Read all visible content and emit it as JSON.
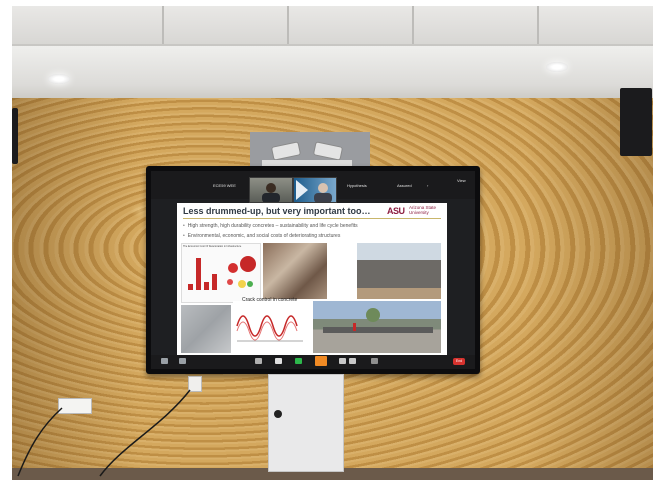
{
  "scene": {
    "description_role": "photo of a conference-room wall display showing a video call",
    "colors": {
      "wall": "#c99a52",
      "screen_bezel": "#0c0c0e",
      "asu_maroon": "#8c1d40",
      "end_button": "#d6322e"
    }
  },
  "zoom_bar": {
    "left_label": "ECE59 WEE",
    "participant_1_name": "",
    "participant_2_name": "",
    "right_label_1": "Hypothesis",
    "right_label_2": "Assured",
    "corner_label": "View"
  },
  "slide": {
    "title": "Less drummed-up, but very important too…",
    "logo_mark": "ASU",
    "logo_name_line1": "Arizona State",
    "logo_name_line2": "University",
    "bullets": [
      "High strength, high durability concretes – sustainability and life cycle benefits",
      "Environmental, economic, and social costs of deteriorating structures"
    ],
    "chart_caption": "The Economic Cost Of Deterioration in Infrastructure",
    "crack_label": "Crack control in concrete"
  },
  "toolbar": {
    "icons": [
      "mute-icon",
      "video-icon",
      "security-icon",
      "participants-icon",
      "chat-icon",
      "share-icon",
      "record-icon",
      "reactions-icon",
      "more-icon"
    ],
    "end_label": "End"
  }
}
